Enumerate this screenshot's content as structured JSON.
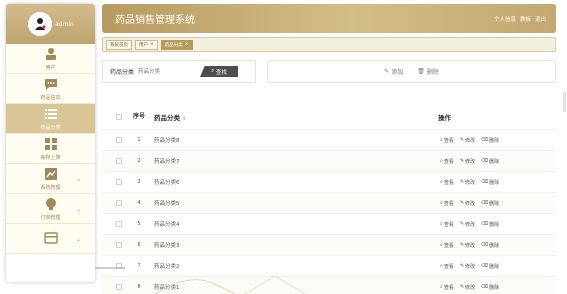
{
  "sidebar": {
    "username": "admin",
    "items": [
      {
        "label": "用户",
        "icon": "user-icon",
        "active": false,
        "has_arrow": false
      },
      {
        "label": "药品信息",
        "icon": "chat-icon",
        "active": false,
        "has_arrow": false
      },
      {
        "label": "药品分类",
        "icon": "list-icon",
        "active": true,
        "has_arrow": false
      },
      {
        "label": "库存上架",
        "icon": "grid-icon",
        "active": false,
        "has_arrow": false
      },
      {
        "label": "系统管理",
        "icon": "trend-icon",
        "active": false,
        "has_arrow": true
      },
      {
        "label": "订单管理",
        "icon": "bulb-icon",
        "active": false,
        "has_arrow": true
      },
      {
        "label": "",
        "icon": "card-icon",
        "active": false,
        "has_arrow": true
      }
    ]
  },
  "header": {
    "title": "药品销售管理系统",
    "links": [
      "个人信息",
      "教板",
      "退出"
    ]
  },
  "tags": [
    {
      "label": "系统首页",
      "active": false,
      "closable": false
    },
    {
      "label": "用户",
      "active": false,
      "closable": true
    },
    {
      "label": "药品分类",
      "active": true,
      "closable": true
    }
  ],
  "search": {
    "label": "药品分类",
    "placeholder": "药品分类",
    "button": "查找"
  },
  "actions": {
    "add": "添加",
    "delete": "删除"
  },
  "table": {
    "headers": {
      "index": "序号",
      "name": "药品分类",
      "sort": "⇕",
      "ops": "操作"
    },
    "ops": {
      "view": "查看",
      "edit": "修改",
      "delete": "删除"
    },
    "rows": [
      {
        "index": "1",
        "name": "药品分类8"
      },
      {
        "index": "2",
        "name": "药品分类7"
      },
      {
        "index": "3",
        "name": "药品分类6"
      },
      {
        "index": "4",
        "name": "药品分类5"
      },
      {
        "index": "5",
        "name": "药品分类4"
      },
      {
        "index": "6",
        "name": "药品分类3"
      },
      {
        "index": "7",
        "name": "药品分类2"
      },
      {
        "index": "8",
        "name": "药品分类1"
      }
    ]
  },
  "colors": {
    "accent": "#b89b5f",
    "sidebar_active": "#d9c596",
    "search_button": "#4d4d4d"
  }
}
